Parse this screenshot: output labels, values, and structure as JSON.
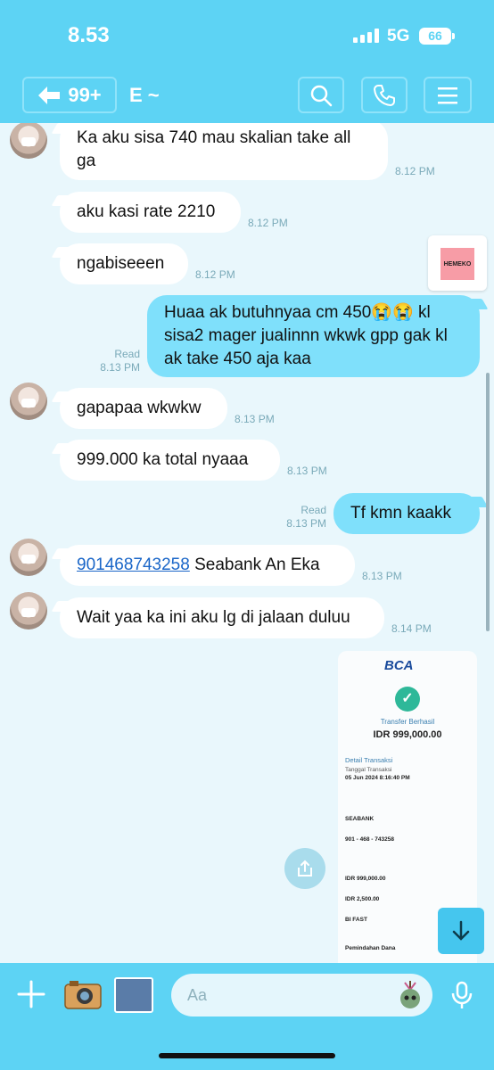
{
  "status_bar": {
    "time": "8.53",
    "network": "5G",
    "battery": "66"
  },
  "header": {
    "back_count": "99+",
    "contact_name": "E ~"
  },
  "messages": [
    {
      "dir": "in",
      "text": "Ka aku sisa 740 mau skalian take all ga",
      "time": "8.12 PM"
    },
    {
      "dir": "in",
      "text": "aku kasi rate 2210",
      "time": "8.12 PM"
    },
    {
      "dir": "in",
      "text": "ngabiseeen",
      "time": "8.12 PM"
    },
    {
      "dir": "out",
      "text": "Huaa ak butuhnyaa cm 450😭😭 kl sisa2  mager jualinnn wkwk gpp gak kl ak take 450 aja kaa",
      "time": "8.13 PM",
      "read": "Read"
    },
    {
      "dir": "in",
      "text": "gapapaa wkwkw",
      "time": "8.13 PM"
    },
    {
      "dir": "in",
      "text": "999.000 ka total nyaaa",
      "time": "8.13 PM"
    },
    {
      "dir": "out",
      "text": "Tf kmn kaakk",
      "time": "8.13 PM",
      "read": "Read"
    },
    {
      "dir": "in",
      "link": "901468743258",
      "text": " Seabank An Eka",
      "time": "8.13 PM"
    },
    {
      "dir": "in",
      "text": "Wait yaa ka ini aku lg di jalaan duluu",
      "time": "8.14 PM"
    }
  ],
  "sticker": {
    "label": "HEMEKO"
  },
  "receipt": {
    "bank": "BCA",
    "status": "Transfer Berhasil",
    "amount": "IDR 999,000.00",
    "detail_title": "Detail Transaksi",
    "date_label": "Tanggal Transaksi",
    "date": "05 Jun 2024 8:16:40 PM",
    "bank_target": "SEABANK",
    "account": "901 - 468 - 743258",
    "amount_line": "IDR 999,000.00",
    "fee": "IDR 2,500.00",
    "method": "BI FAST",
    "note": "Pemindahan Dana"
  },
  "composer": {
    "placeholder": "Aa"
  },
  "colors": {
    "header": "#5dd3f4",
    "out_bubble": "#7fe0fb",
    "background": "#e9f7fc"
  }
}
